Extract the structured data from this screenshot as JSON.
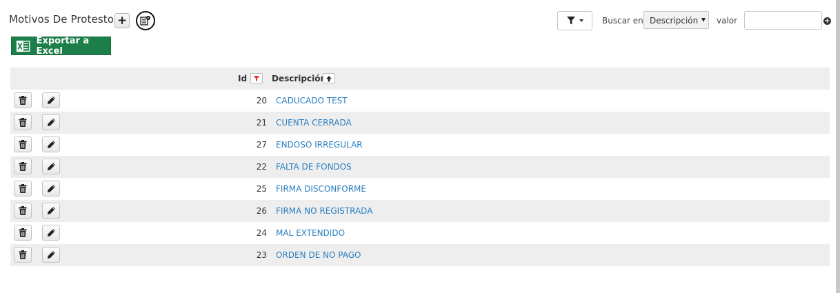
{
  "page": {
    "title": "Motivos De Protesto"
  },
  "toolbar": {
    "search_in_label": "Buscar en",
    "search_field_selected": "Descripción",
    "value_label": "valor",
    "value_input": "",
    "export_label": "Exportar a Excel"
  },
  "table": {
    "columns": [
      {
        "label": "Id"
      },
      {
        "label": "Descripción"
      }
    ],
    "rows": [
      {
        "id": "20",
        "descripcion": "CADUCADO TEST"
      },
      {
        "id": "21",
        "descripcion": "CUENTA CERRADA"
      },
      {
        "id": "27",
        "descripcion": "ENDOSO IRREGULAR"
      },
      {
        "id": "22",
        "descripcion": "FALTA DE FONDOS"
      },
      {
        "id": "25",
        "descripcion": "FIRMA DISCONFORME"
      },
      {
        "id": "26",
        "descripcion": "FIRMA NO REGISTRADA"
      },
      {
        "id": "24",
        "descripcion": "MAL EXTENDIDO"
      },
      {
        "id": "23",
        "descripcion": "ORDEN DE NO PAGO"
      }
    ]
  },
  "icons": [
    "plus-icon",
    "settings-icon",
    "filter-icon",
    "chevron-down-icon",
    "excel-icon",
    "funnel-sort-icon",
    "arrow-up-icon",
    "trash-icon",
    "pencil-icon",
    "add-circle-icon"
  ],
  "colors": {
    "excel_button": "#1c7f49",
    "link": "#2a7fc0",
    "row_stripe": "#eeeeee",
    "filter_active": "#e03a2f"
  }
}
